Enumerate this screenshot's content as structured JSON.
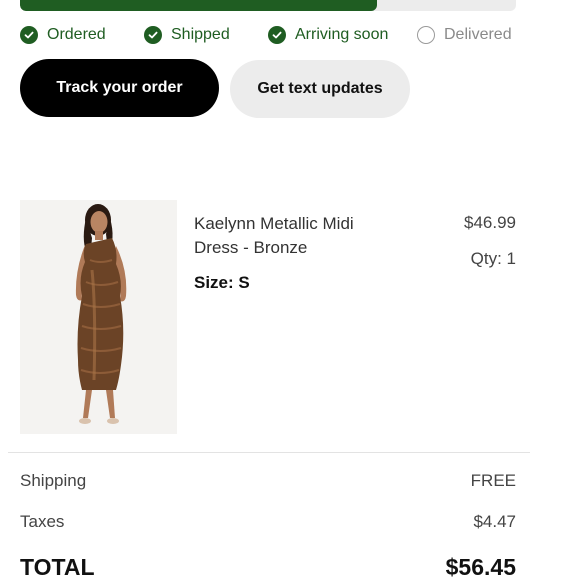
{
  "progress": {
    "fraction": 0.72,
    "fill_color": "#1f5d22",
    "track_color": "#ececec"
  },
  "steps": [
    {
      "label": "Ordered",
      "done": true,
      "icon": "check-circle-icon"
    },
    {
      "label": "Shipped",
      "done": true,
      "icon": "check-circle-icon"
    },
    {
      "label": "Arriving soon",
      "done": true,
      "icon": "check-circle-icon"
    },
    {
      "label": "Delivered",
      "done": false,
      "icon": "empty-circle-icon"
    }
  ],
  "actions": {
    "track_label": "Track your order",
    "text_updates_label": "Get text updates"
  },
  "product": {
    "name": "Kaelynn Metallic Midi Dress - Bronze",
    "size": "Size: S",
    "price": "$46.99",
    "qty": "Qty: 1"
  },
  "summary": {
    "shipping_label": "Shipping",
    "shipping_value": "FREE",
    "taxes_label": "Taxes",
    "taxes_value": "$4.47",
    "total_label": "TOTAL",
    "total_value": "$56.45"
  }
}
